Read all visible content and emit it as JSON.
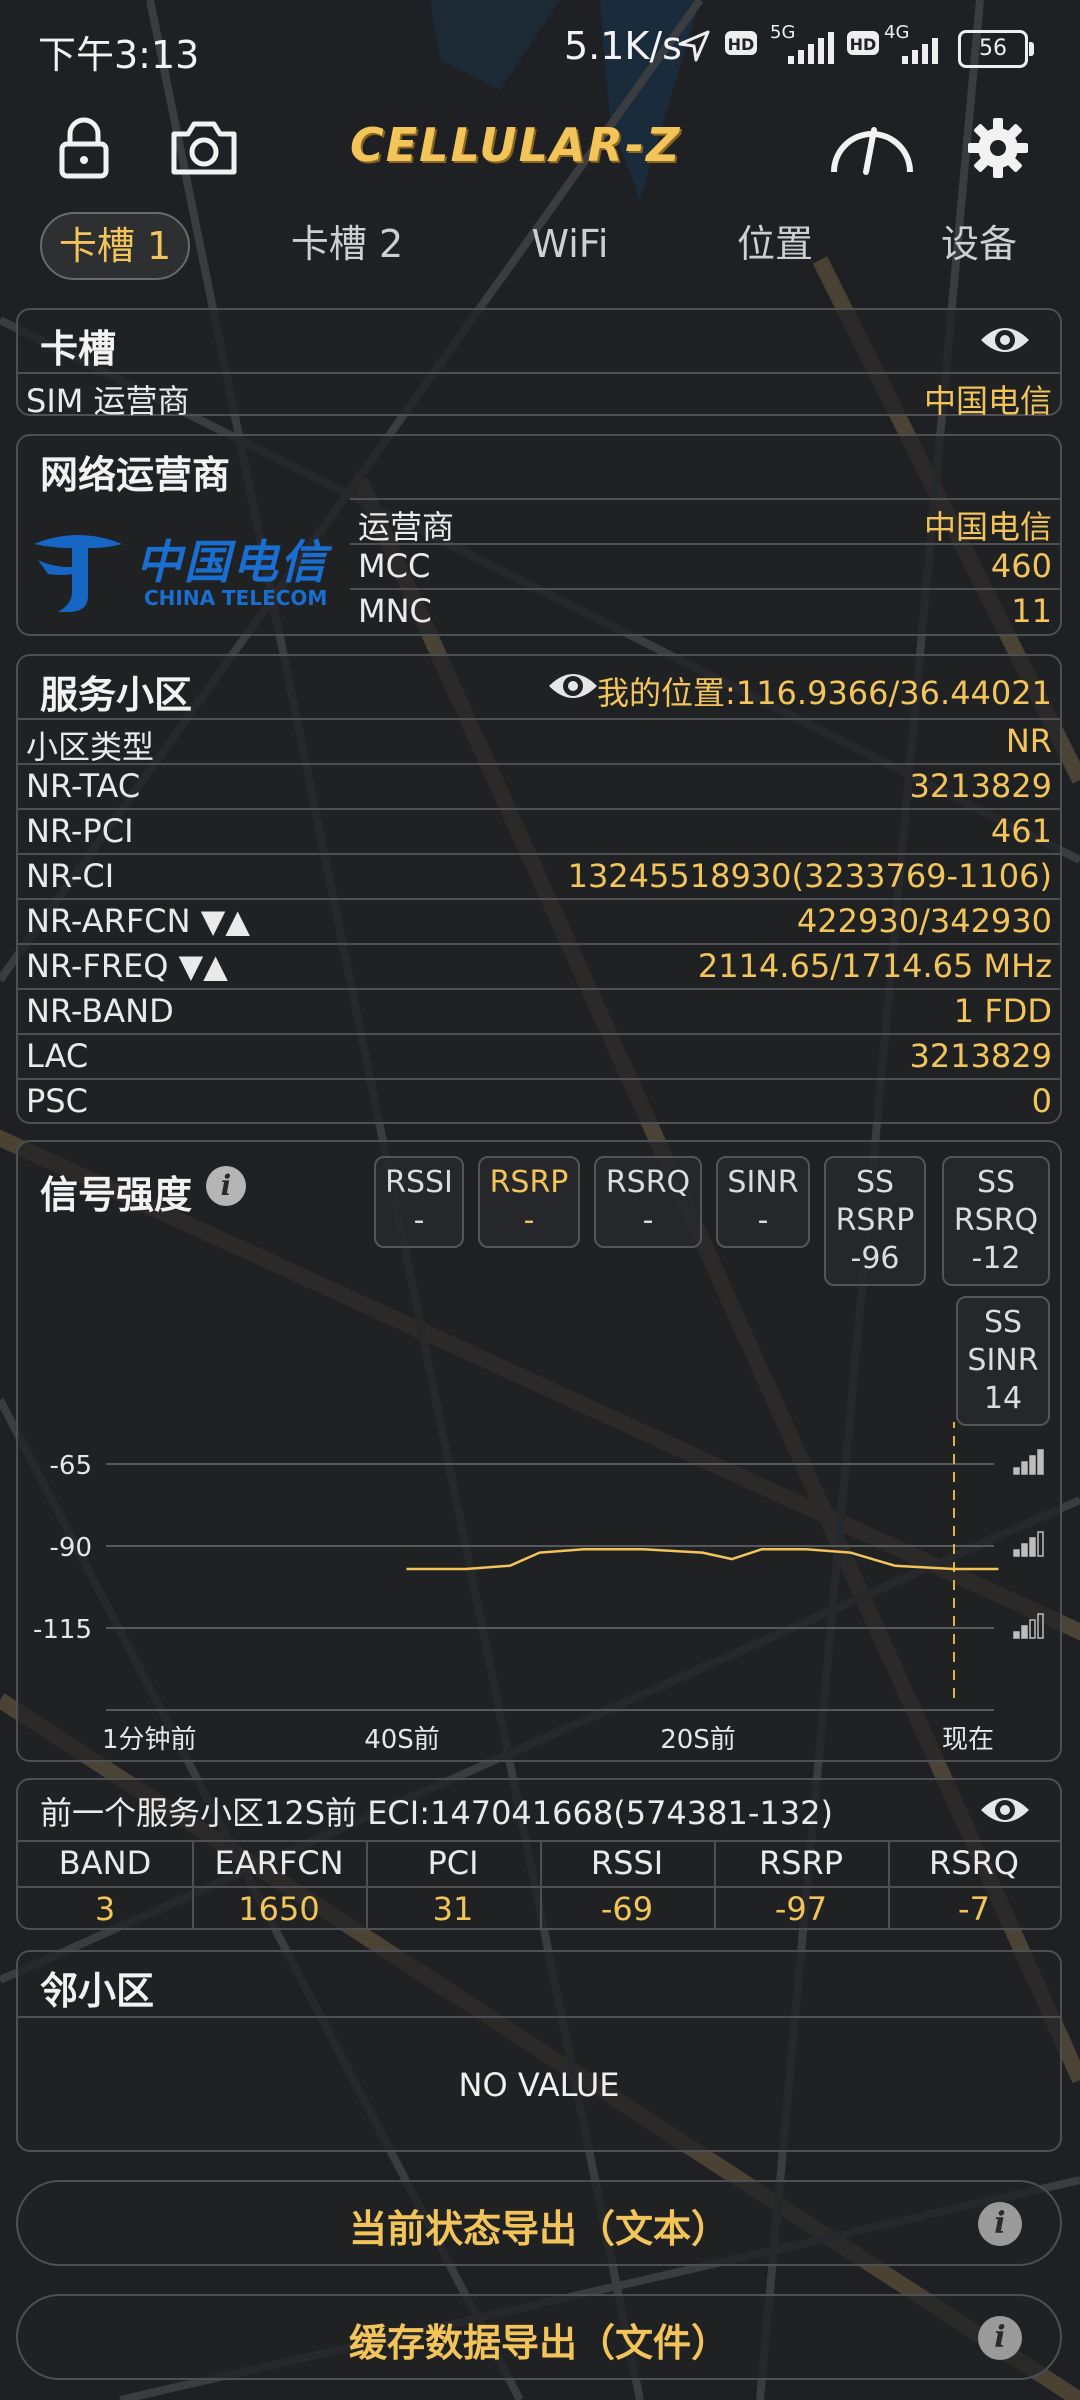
{
  "status_bar": {
    "time": "下午3:13",
    "speed": "5.1K/s",
    "sim1_net": "5G",
    "sim2_net": "4G",
    "battery": "56"
  },
  "toolbar": {
    "app_name": "CELLULAR-Z",
    "icons": [
      "lock-icon",
      "camera-icon",
      "speedometer-icon",
      "gear-icon"
    ]
  },
  "tabs": [
    {
      "label": "卡槽 1",
      "active": true
    },
    {
      "label": "卡槽 2",
      "active": false
    },
    {
      "label": "WiFi",
      "active": false
    },
    {
      "label": "位置",
      "active": false
    },
    {
      "label": "设备",
      "active": false
    }
  ],
  "slot": {
    "title": "卡槽",
    "sim_operator_label": "SIM 运营商",
    "sim_operator_value": "中国电信"
  },
  "network_operator": {
    "title": "网络运营商",
    "logo_cn": "中国电信",
    "logo_en": "CHINA TELECOM",
    "rows": [
      {
        "label": "运营商",
        "value": "中国电信"
      },
      {
        "label": "MCC",
        "value": "460"
      },
      {
        "label": "MNC",
        "value": "11"
      }
    ]
  },
  "serving_cell": {
    "title": "服务小区",
    "location": "我的位置:116.9366/36.44021",
    "rows": [
      {
        "label": "小区类型",
        "value": "NR"
      },
      {
        "label": "NR-TAC",
        "value": "3213829"
      },
      {
        "label": "NR-PCI",
        "value": "461"
      },
      {
        "label": "NR-CI",
        "value": "13245518930(3233769-1106)"
      },
      {
        "label": "NR-ARFCN ▼▲",
        "value": "422930/342930"
      },
      {
        "label": "NR-FREQ ▼▲",
        "value": "2114.65/1714.65 MHz"
      },
      {
        "label": "NR-BAND",
        "value": "1 FDD"
      },
      {
        "label": "LAC",
        "value": "3213829"
      },
      {
        "label": "PSC",
        "value": "0"
      }
    ]
  },
  "signal": {
    "title": "信号强度",
    "boxes": [
      {
        "lines": [
          "RSSI",
          "-"
        ],
        "highlight": false
      },
      {
        "lines": [
          "RSRP",
          "-"
        ],
        "highlight": true
      },
      {
        "lines": [
          "RSRQ",
          "-"
        ],
        "highlight": false
      },
      {
        "lines": [
          "SINR",
          "-"
        ],
        "highlight": false
      },
      {
        "lines": [
          "SS",
          "RSRP",
          "-96"
        ],
        "highlight": false
      },
      {
        "lines": [
          "SS",
          "RSRQ",
          "-12"
        ],
        "highlight": false
      },
      {
        "lines": [
          "SS",
          "SINR",
          "14"
        ],
        "highlight": false
      }
    ]
  },
  "chart_data": {
    "type": "line",
    "title": "",
    "xlabel": "",
    "ylabel": "",
    "y_ticks": [
      "-65",
      "-90",
      "-115"
    ],
    "x_ticks": [
      "1分钟前",
      "40S前",
      "20S前",
      "现在"
    ],
    "ylim": [
      -140,
      -65
    ],
    "series": [
      {
        "color": "#f2c45a",
        "x": [
          -37,
          -33,
          -30,
          -28,
          -25,
          -21,
          -17,
          -15,
          -13,
          -10,
          -7,
          -4,
          0,
          3
        ],
        "values": [
          -97,
          -97,
          -96,
          -92,
          -91,
          -91,
          -92,
          -94,
          -91,
          -91,
          -92,
          -96,
          -97,
          -97
        ]
      }
    ],
    "marker_x": 0
  },
  "previous_cell": {
    "title": "前一个服务小区12S前 ECI:147041668(574381-132)",
    "headers": [
      "BAND",
      "EARFCN",
      "PCI",
      "RSSI",
      "RSRP",
      "RSRQ"
    ],
    "values": [
      "3",
      "1650",
      "31",
      "-69",
      "-97",
      "-7"
    ]
  },
  "neighbor": {
    "title": "邻小区",
    "empty_text": "NO VALUE"
  },
  "exports": [
    {
      "label": "当前状态导出（文本）"
    },
    {
      "label": "缓存数据导出（文件）"
    }
  ],
  "colors": {
    "accent": "#f2c45a",
    "background": "#1f2124",
    "border": "#4d4f52"
  }
}
